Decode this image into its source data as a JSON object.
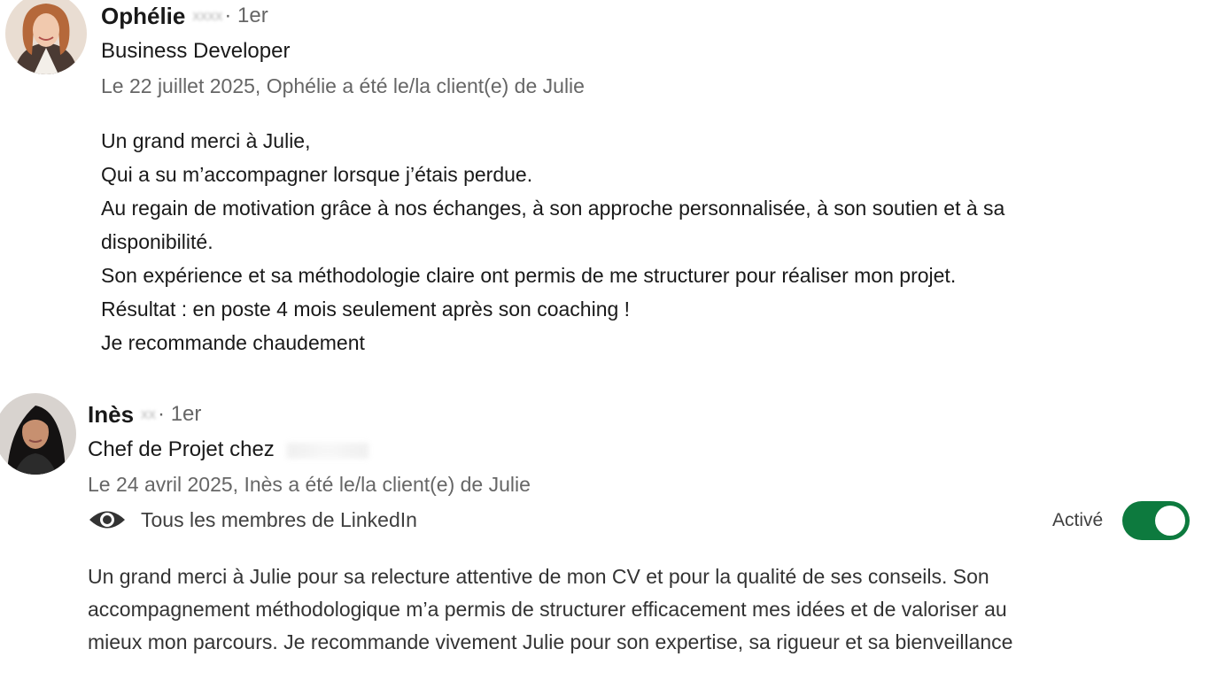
{
  "recommendations": [
    {
      "name": "Ophélie",
      "name_suffix_redacted": "xxxx",
      "degree": "· 1er",
      "headline": "Business Developer",
      "headline_company_redacted": "",
      "meta": "Le 22 juillet 2025, Ophélie a été le/la client(e) de Julie",
      "text_lines": [
        "Un grand merci à Julie,",
        "Qui a su m’accompagner lorsque j’étais perdue.",
        "Au regain de motivation grâce à nos échanges, à son approche personnalisée, à son soutien et à sa",
        "disponibilité.",
        "Son expérience et sa méthodologie claire ont permis de me structurer pour réaliser mon projet.",
        "Résultat : en poste 4 mois seulement après son coaching !",
        "Je recommande chaudement"
      ]
    },
    {
      "name": "Inès",
      "name_suffix_redacted": "xx",
      "degree": "· 1er",
      "headline": "Chef de Projet chez",
      "headline_company_redacted": "xxxxx",
      "meta": "Le 24 avril 2025, Inès a été le/la client(e) de Julie",
      "visibility_label": "Tous les membres de LinkedIn",
      "toggle_label": "Activé",
      "toggle_on": true,
      "text_lines": [
        "Un grand merci à Julie pour sa relecture attentive de mon CV et pour la qualité de ses conseils. Son",
        "accompagnement méthodologique m’a permis de structurer efficacement mes idées et de valoriser au",
        "mieux mon parcours. Je recommande vivement Julie pour son expertise, sa rigueur et sa bienveillance"
      ]
    }
  ],
  "colors": {
    "toggle_active": "#0d7a3e",
    "secondary_text": "#666666"
  },
  "icons": {
    "visibility": "eye-icon"
  }
}
